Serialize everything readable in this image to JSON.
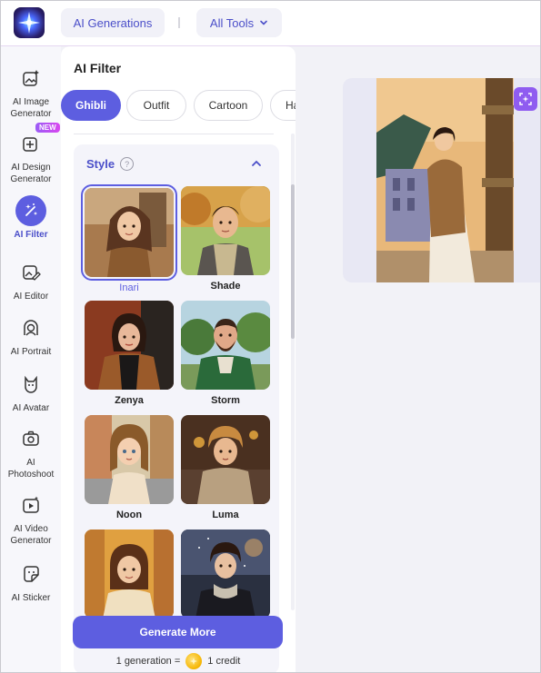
{
  "topbar": {
    "ai_generations_label": "AI Generations",
    "all_tools_label": "All Tools"
  },
  "sidebar": {
    "items": [
      {
        "label": "AI Image Generator",
        "icon": "image-generate-icon"
      },
      {
        "label": "AI Design Generator",
        "icon": "design-icon",
        "badge": "NEW"
      },
      {
        "label": "AI Filter",
        "icon": "magic-wand-icon",
        "active": true
      },
      {
        "label": "AI Editor",
        "icon": "edit-image-icon"
      },
      {
        "label": "AI Portrait",
        "icon": "portrait-icon"
      },
      {
        "label": "AI Avatar",
        "icon": "avatar-icon"
      },
      {
        "label": "AI Photoshoot",
        "icon": "camera-icon"
      },
      {
        "label": "AI Video Generator",
        "icon": "video-icon"
      },
      {
        "label": "AI Sticker",
        "icon": "sticker-icon"
      }
    ]
  },
  "panel": {
    "title": "AI Filter",
    "chips": [
      "Ghibli",
      "Outfit",
      "Cartoon",
      "Ha"
    ],
    "active_chip": "Ghibli",
    "style_section": {
      "title": "Style",
      "help": "?",
      "styles": [
        {
          "name": "Inari",
          "selected": true
        },
        {
          "name": "Shade"
        },
        {
          "name": "Zenya"
        },
        {
          "name": "Storm"
        },
        {
          "name": "Noon"
        },
        {
          "name": "Luma"
        },
        {
          "name": ""
        },
        {
          "name": ""
        }
      ]
    },
    "generate_button": "Generate More",
    "credit": {
      "left": "1 generation =",
      "right": "1 credit"
    }
  },
  "colors": {
    "accent": "#5d5ee0",
    "accent_text": "#4b4fc9",
    "badge": "#b25cf0"
  }
}
